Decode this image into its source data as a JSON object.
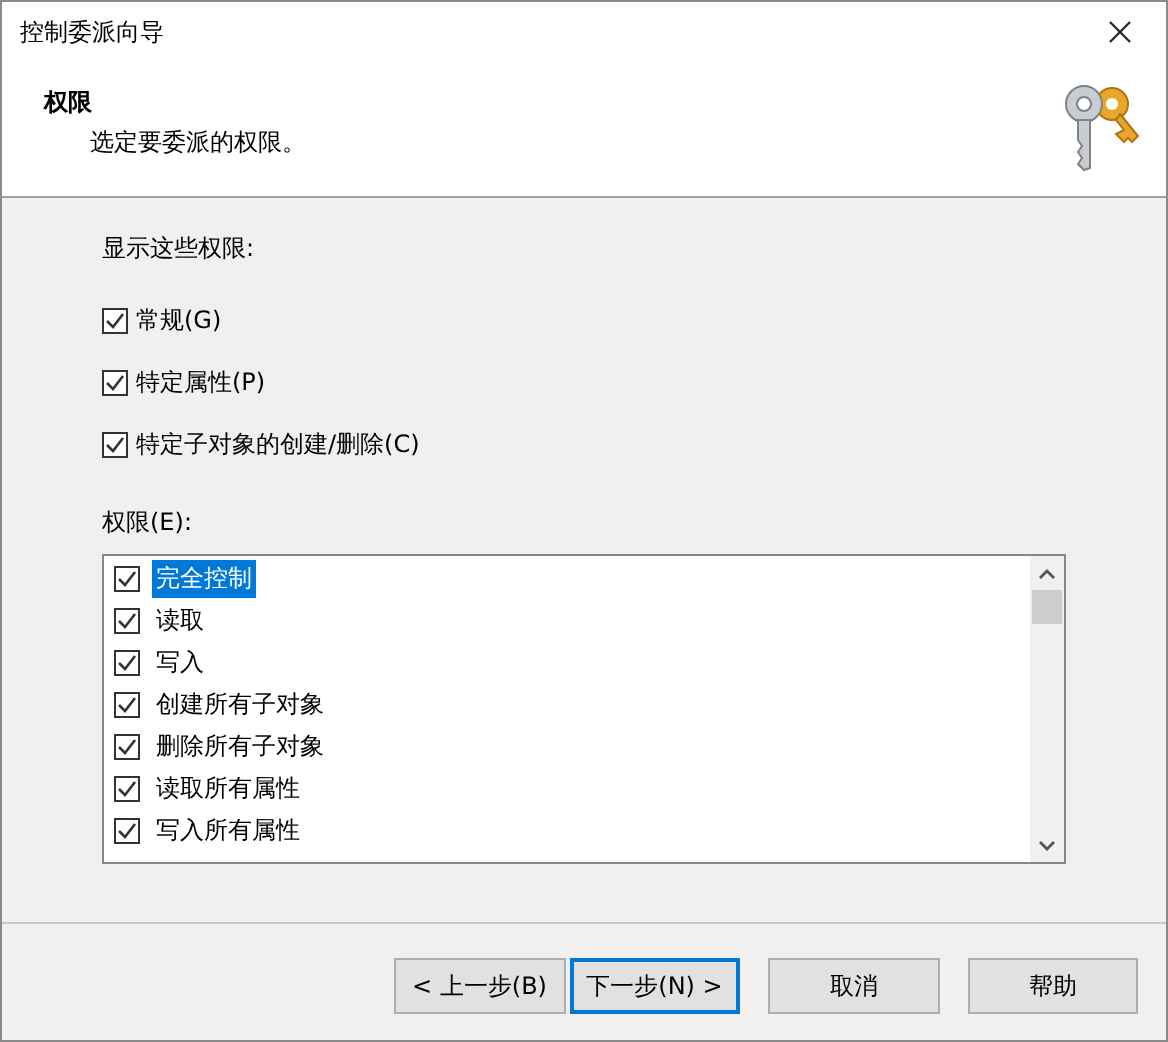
{
  "window": {
    "title": "控制委派向导"
  },
  "header": {
    "title": "权限",
    "subtitle": "选定要委派的权限。"
  },
  "filter": {
    "label": "显示这些权限:",
    "options": [
      {
        "label": "常规(G)",
        "checked": true
      },
      {
        "label": "特定属性(P)",
        "checked": true
      },
      {
        "label": "特定子对象的创建/删除(C)",
        "checked": true
      }
    ]
  },
  "permissions": {
    "label": "权限(E):",
    "items": [
      {
        "label": "完全控制",
        "checked": true,
        "selected": true
      },
      {
        "label": "读取",
        "checked": true,
        "selected": false
      },
      {
        "label": "写入",
        "checked": true,
        "selected": false
      },
      {
        "label": "创建所有子对象",
        "checked": true,
        "selected": false
      },
      {
        "label": "删除所有子对象",
        "checked": true,
        "selected": false
      },
      {
        "label": "读取所有属性",
        "checked": true,
        "selected": false
      },
      {
        "label": "写入所有属性",
        "checked": true,
        "selected": false
      }
    ]
  },
  "buttons": [
    {
      "label": "< 上一步(B)",
      "focused": false
    },
    {
      "label": "下一步(N) >",
      "focused": true
    },
    {
      "label": "取消",
      "focused": false
    },
    {
      "label": "帮助",
      "focused": false
    }
  ]
}
